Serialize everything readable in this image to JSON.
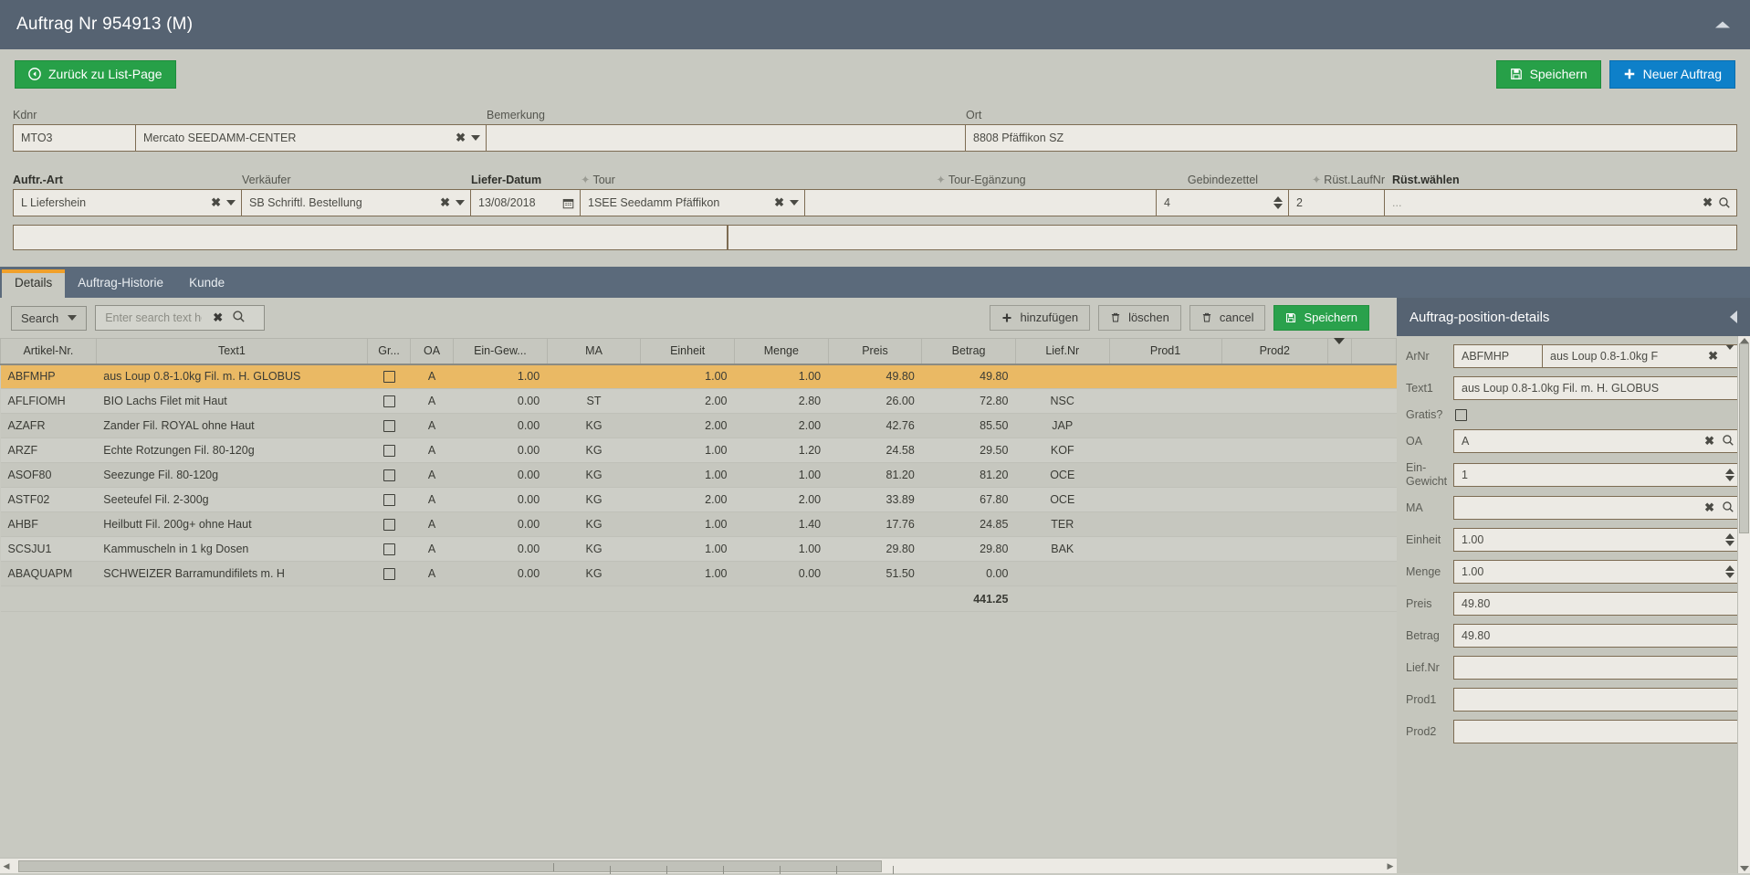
{
  "window": {
    "title": "Auftrag Nr 954913 (M)",
    "collapse_icon": "caret-up-icon"
  },
  "actionbar": {
    "back_label": "Zurück zu List-Page",
    "back_icon": "back-circle-icon",
    "save_label": "Speichern",
    "save_icon": "floppy-disk-icon",
    "new_label": "Neuer Auftrag",
    "new_icon": "plus-icon"
  },
  "form": {
    "row1": {
      "kdnr_label": "Kdnr",
      "kdnr_code": "MTO3",
      "kdnr_name": "Mercato SEEDAMM-CENTER",
      "bemerkung_label": "Bemerkung",
      "bemerkung_value": "",
      "ort_label": "Ort",
      "ort_value": "8808 Pfäffikon SZ"
    },
    "row2": {
      "auftrart_label": "Auftr.-Art",
      "auftrart_value": "L Liefershein",
      "verkaeufer_label": "Verkäufer",
      "verkaeufer_value": "SB Schriftl. Bestellung",
      "lieferdatum_label": "Liefer-Datum",
      "lieferdatum_value": "13/08/2018",
      "tour_label": "Tour",
      "tour_value": "1SEE Seedamm Pfäffikon",
      "tourerg_label": "Tour-Egänzung",
      "tourerg_value": "",
      "gebindezettel_label": "Gebindezettel",
      "gebindezettel_value": "4",
      "ruestlaufnr_label": "Rüst.LaufNr",
      "ruestlaufnr_value": "2",
      "ruestwaehlen_label": "Rüst.wählen",
      "ruestwaehlen_value": "...",
      "star": "★"
    },
    "notes": {
      "left_value": "",
      "right_value": ""
    }
  },
  "tabs": [
    {
      "label": "Details",
      "active": true
    },
    {
      "label": "Auftrag-Historie",
      "active": false
    },
    {
      "label": "Kunde",
      "active": false
    }
  ],
  "gridtoolbar": {
    "search_dropdown_label": "Search",
    "search_placeholder": "Enter search text here...",
    "search_value": "",
    "clear_icon": "clear-x-icon",
    "search_icon": "magnifier-icon",
    "add_label": "hinzufügen",
    "add_icon": "plus-icon",
    "delete_label": "löschen",
    "delete_icon": "trash-icon",
    "cancel_label": "cancel",
    "cancel_icon": "trash-icon",
    "save_label": "Speichern",
    "save_icon": "floppy-disk-icon"
  },
  "grid": {
    "columns": [
      "Artikel-Nr.",
      "Text1",
      "Gr...",
      "OA",
      "Ein-Gew...",
      "MA",
      "Einheit",
      "Menge",
      "Preis",
      "Betrag",
      "Lief.Nr",
      "Prod1",
      "Prod2"
    ],
    "rows": [
      {
        "artikel": "ABFMHP",
        "text1": "aus Loup 0.8-1.0kg Fil. m. H. GLOBUS",
        "gr": false,
        "oa": "A",
        "eingew": "1.00",
        "ma": "",
        "einheit": "1.00",
        "menge": "1.00",
        "preis": "49.80",
        "betrag": "49.80",
        "liefnr": "",
        "prod1": "",
        "prod2": "",
        "selected": true
      },
      {
        "artikel": "AFLFIOMH",
        "text1": "BIO Lachs Filet mit Haut",
        "gr": false,
        "oa": "A",
        "eingew": "0.00",
        "ma": "ST",
        "einheit": "2.00",
        "menge": "2.80",
        "preis": "26.00",
        "betrag": "72.80",
        "liefnr": "NSC",
        "prod1": "",
        "prod2": "",
        "selected": false
      },
      {
        "artikel": "AZAFR",
        "text1": "Zander Fil. ROYAL ohne Haut",
        "gr": false,
        "oa": "A",
        "eingew": "0.00",
        "ma": "KG",
        "einheit": "2.00",
        "menge": "2.00",
        "preis": "42.76",
        "betrag": "85.50",
        "liefnr": "JAP",
        "prod1": "",
        "prod2": "",
        "selected": false
      },
      {
        "artikel": "ARZF",
        "text1": "Echte Rotzungen Fil. 80-120g",
        "gr": false,
        "oa": "A",
        "eingew": "0.00",
        "ma": "KG",
        "einheit": "1.00",
        "menge": "1.20",
        "preis": "24.58",
        "betrag": "29.50",
        "liefnr": "KOF",
        "prod1": "",
        "prod2": "",
        "selected": false
      },
      {
        "artikel": "ASOF80",
        "text1": "Seezunge Fil. 80-120g",
        "gr": false,
        "oa": "A",
        "eingew": "0.00",
        "ma": "KG",
        "einheit": "1.00",
        "menge": "1.00",
        "preis": "81.20",
        "betrag": "81.20",
        "liefnr": "OCE",
        "prod1": "",
        "prod2": "",
        "selected": false
      },
      {
        "artikel": "ASTF02",
        "text1": "Seeteufel Fil. 2-300g",
        "gr": false,
        "oa": "A",
        "eingew": "0.00",
        "ma": "KG",
        "einheit": "2.00",
        "menge": "2.00",
        "preis": "33.89",
        "betrag": "67.80",
        "liefnr": "OCE",
        "prod1": "",
        "prod2": "",
        "selected": false
      },
      {
        "artikel": "AHBF",
        "text1": "Heilbutt Fil. 200g+ ohne Haut",
        "gr": false,
        "oa": "A",
        "eingew": "0.00",
        "ma": "KG",
        "einheit": "1.00",
        "menge": "1.40",
        "preis": "17.76",
        "betrag": "24.85",
        "liefnr": "TER",
        "prod1": "",
        "prod2": "",
        "selected": false
      },
      {
        "artikel": "SCSJU1",
        "text1": "Kammuscheln in 1 kg Dosen",
        "gr": false,
        "oa": "A",
        "eingew": "0.00",
        "ma": "KG",
        "einheit": "1.00",
        "menge": "1.00",
        "preis": "29.80",
        "betrag": "29.80",
        "liefnr": "BAK",
        "prod1": "",
        "prod2": "",
        "selected": false
      },
      {
        "artikel": "ABAQUAPM",
        "text1": "SCHWEIZER Barramundifilets m. H",
        "gr": false,
        "oa": "A",
        "eingew": "0.00",
        "ma": "KG",
        "einheit": "1.00",
        "menge": "0.00",
        "preis": "51.50",
        "betrag": "0.00",
        "liefnr": "",
        "prod1": "",
        "prod2": "",
        "selected": false
      }
    ],
    "total_betrag": "441.25"
  },
  "details_panel": {
    "title": "Auftrag-position-details",
    "collapse_icon": "caret-left-icon",
    "fields": {
      "arnr_label": "ArNr",
      "arnr_code": "ABFMHP",
      "arnr_text": "aus Loup 0.8-1.0kg F",
      "text1_label": "Text1",
      "text1_value": "aus Loup 0.8-1.0kg Fil. m. H. GLOBUS",
      "gratis_label": "Gratis?",
      "gratis_checked": false,
      "oa_label": "OA",
      "oa_value": "A",
      "eingewicht_label": "Ein-Gewicht",
      "eingewicht_value": "1",
      "ma_label": "MA",
      "ma_value": "",
      "einheit_label": "Einheit",
      "einheit_value": "1.00",
      "menge_label": "Menge",
      "menge_value": "1.00",
      "preis_label": "Preis",
      "preis_value": "49.80",
      "betrag_label": "Betrag",
      "betrag_value": "49.80",
      "liefnr_label": "Lief.Nr",
      "liefnr_value": "",
      "prod1_label": "Prod1",
      "prod1_value": "",
      "prod2_label": "Prod2",
      "prod2_value": ""
    }
  },
  "colors": {
    "titlebar": "#566372",
    "page_bg": "#c8c9c1",
    "field_bg": "#eceae4",
    "field_border": "#7d6c53",
    "accent_orange": "#f0a02a",
    "row_selected": "#eab964",
    "green": "#27a048",
    "blue": "#0e80c9"
  }
}
